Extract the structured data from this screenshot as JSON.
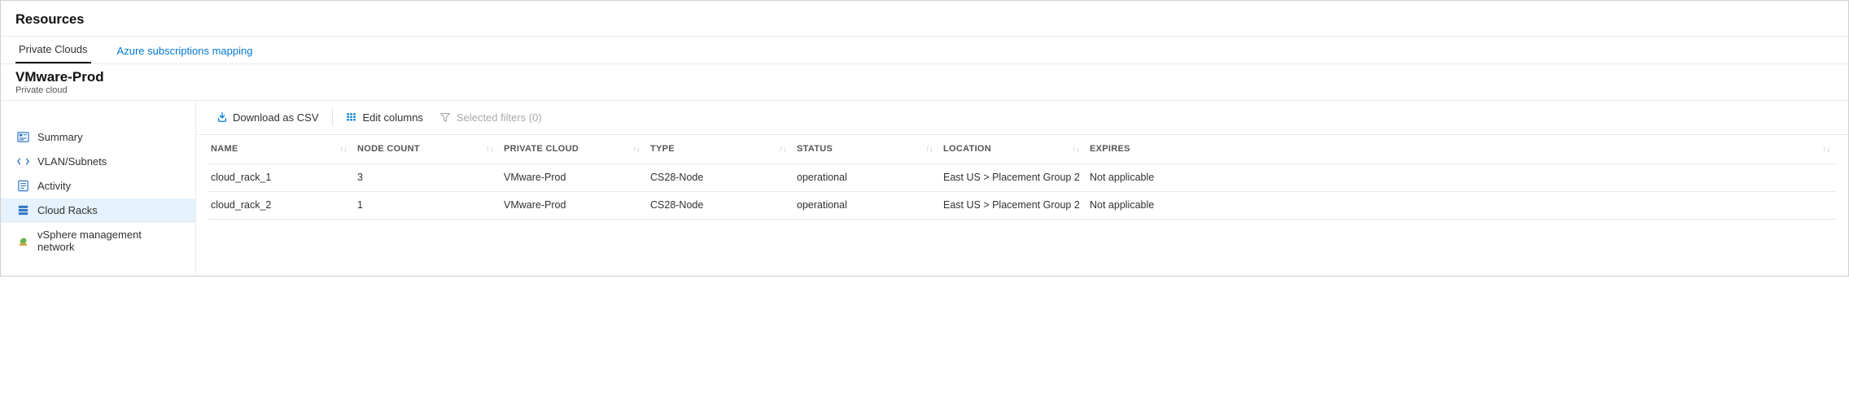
{
  "header": {
    "title": "Resources"
  },
  "tabs": [
    {
      "label": "Private Clouds",
      "active": true
    },
    {
      "label": "Azure subscriptions mapping",
      "active": false
    }
  ],
  "sub": {
    "title": "VMware-Prod",
    "subtitle": "Private cloud"
  },
  "sidebar": {
    "items": [
      {
        "label": "Summary",
        "icon": "summary-icon"
      },
      {
        "label": "VLAN/Subnets",
        "icon": "vlan-icon"
      },
      {
        "label": "Activity",
        "icon": "activity-icon"
      },
      {
        "label": "Cloud Racks",
        "icon": "racks-icon",
        "active": true
      },
      {
        "label": "vSphere management network",
        "icon": "vsphere-icon"
      }
    ]
  },
  "toolbar": {
    "download": "Download as CSV",
    "edit": "Edit columns",
    "filters": "Selected filters (0)"
  },
  "columns": [
    {
      "label": "NAME"
    },
    {
      "label": "NODE COUNT"
    },
    {
      "label": "PRIVATE CLOUD"
    },
    {
      "label": "TYPE"
    },
    {
      "label": "STATUS"
    },
    {
      "label": "LOCATION"
    },
    {
      "label": "EXPIRES"
    }
  ],
  "rows": [
    {
      "name": "cloud_rack_1",
      "nodeCount": "3",
      "privateCloud": "VMware-Prod",
      "type": "CS28-Node",
      "status": "operational",
      "location": "East US > Placement Group 2",
      "expires": "Not applicable"
    },
    {
      "name": "cloud_rack_2",
      "nodeCount": "1",
      "privateCloud": "VMware-Prod",
      "type": "CS28-Node",
      "status": "operational",
      "location": "East US > Placement Group 2",
      "expires": "Not applicable"
    }
  ]
}
